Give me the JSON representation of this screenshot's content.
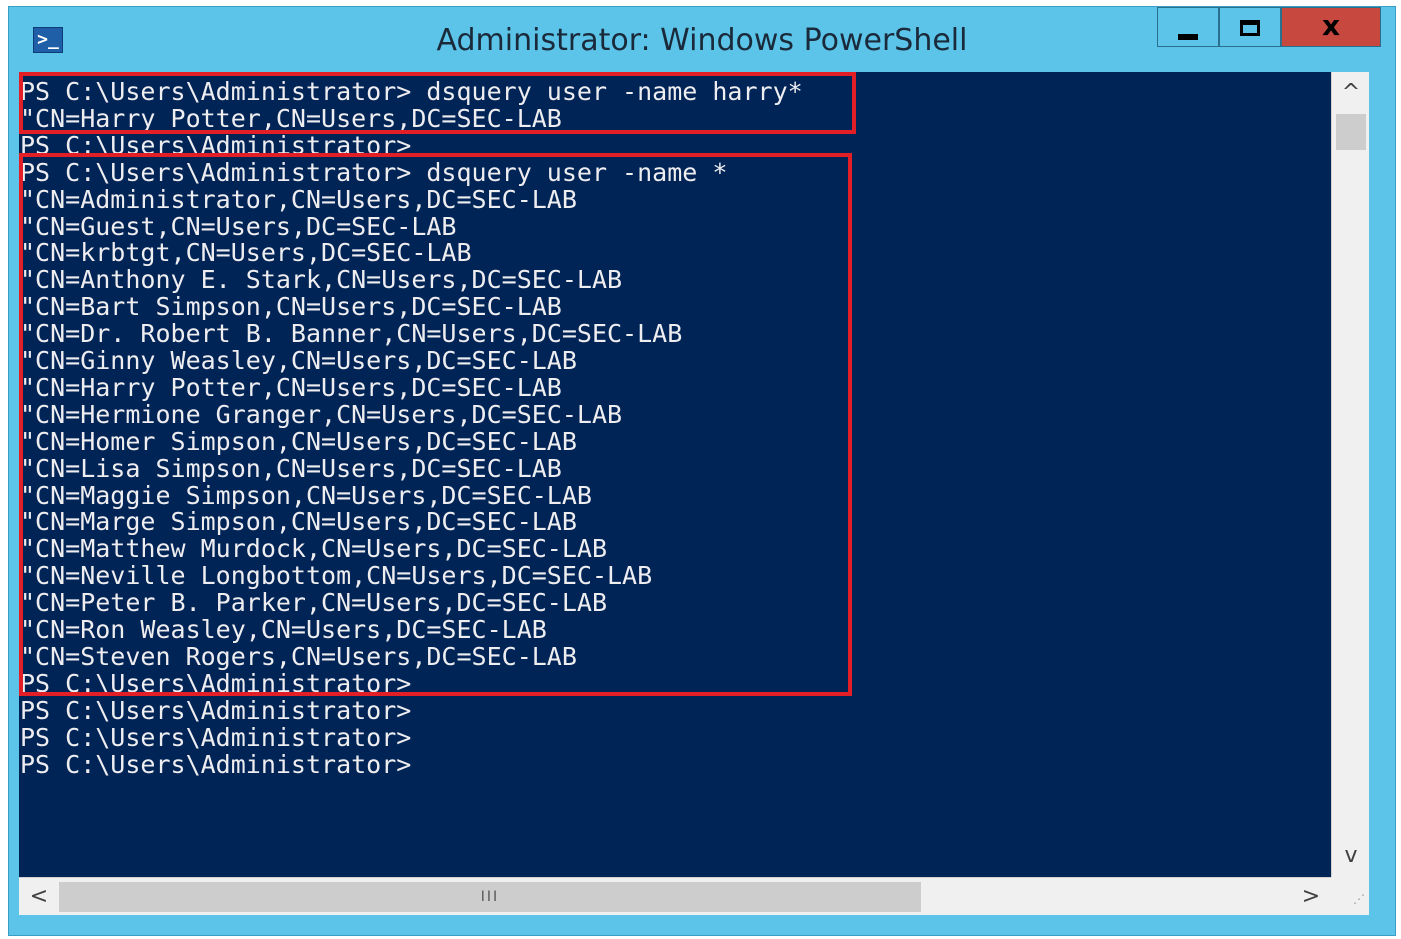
{
  "window": {
    "title": "Administrator: Windows PowerShell",
    "icon": "powershell-icon",
    "controls": {
      "minimize_icon": "minimize-icon",
      "maximize_icon": "maximize-icon",
      "close_label": "x"
    }
  },
  "console": {
    "lines": [
      "PS C:\\Users\\Administrator> dsquery user -name harry*",
      "\"CN=Harry Potter,CN=Users,DC=SEC-LAB",
      "PS C:\\Users\\Administrator>",
      "PS C:\\Users\\Administrator> dsquery user -name *",
      "\"CN=Administrator,CN=Users,DC=SEC-LAB",
      "\"CN=Guest,CN=Users,DC=SEC-LAB",
      "\"CN=krbtgt,CN=Users,DC=SEC-LAB",
      "\"CN=Anthony E. Stark,CN=Users,DC=SEC-LAB",
      "\"CN=Bart Simpson,CN=Users,DC=SEC-LAB",
      "\"CN=Dr. Robert B. Banner,CN=Users,DC=SEC-LAB",
      "\"CN=Ginny Weasley,CN=Users,DC=SEC-LAB",
      "\"CN=Harry Potter,CN=Users,DC=SEC-LAB",
      "\"CN=Hermione Granger,CN=Users,DC=SEC-LAB",
      "\"CN=Homer Simpson,CN=Users,DC=SEC-LAB",
      "\"CN=Lisa Simpson,CN=Users,DC=SEC-LAB",
      "\"CN=Maggie Simpson,CN=Users,DC=SEC-LAB",
      "\"CN=Marge Simpson,CN=Users,DC=SEC-LAB",
      "\"CN=Matthew Murdock,CN=Users,DC=SEC-LAB",
      "\"CN=Neville Longbottom,CN=Users,DC=SEC-LAB",
      "\"CN=Peter B. Parker,CN=Users,DC=SEC-LAB",
      "\"CN=Ron Weasley,CN=Users,DC=SEC-LAB",
      "\"CN=Steven Rogers,CN=Users,DC=SEC-LAB",
      "PS C:\\Users\\Administrator>",
      "PS C:\\Users\\Administrator>",
      "PS C:\\Users\\Administrator>",
      "PS C:\\Users\\Administrator>"
    ],
    "background_color": "#012456",
    "text_color": "#eeedf0",
    "highlight_color": "#e21f26"
  },
  "scrollbars": {
    "up_arrow": "^",
    "down_arrow": "v",
    "left_arrow": "<",
    "right_arrow": ">",
    "thumb_grip": "III"
  }
}
